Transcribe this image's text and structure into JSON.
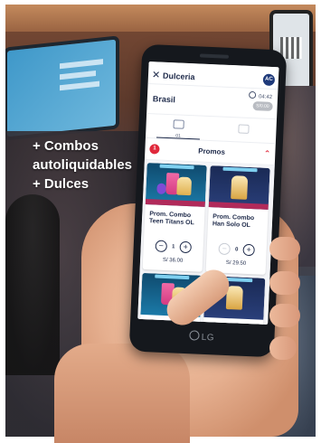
{
  "promo_text": {
    "line1": "+ Combos",
    "line2": "autoliquidables",
    "line3": "+ Dulces"
  },
  "app": {
    "title": "Dulceria",
    "avatar_initials": "AC",
    "close_icon": "close-icon",
    "location": "Brasil",
    "timer": "04:42",
    "cart_total": "S/0.00",
    "tab_count": "01",
    "section_number": "1",
    "section_title": "Promos",
    "section_chevron": "chevron-up-icon"
  },
  "products": [
    {
      "name": "Prom. Combo Teen Titans OL",
      "quantity": "1",
      "price": "S/ 36.00"
    },
    {
      "name": "Prom. Combo Han Solo OL",
      "quantity": "0",
      "price": "S/ 29.50"
    }
  ],
  "device": {
    "brand": "LG"
  },
  "colors": {
    "accent_red": "#e0283b",
    "navy": "#1e2a4a",
    "avatar_blue": "#1f3a7a"
  }
}
